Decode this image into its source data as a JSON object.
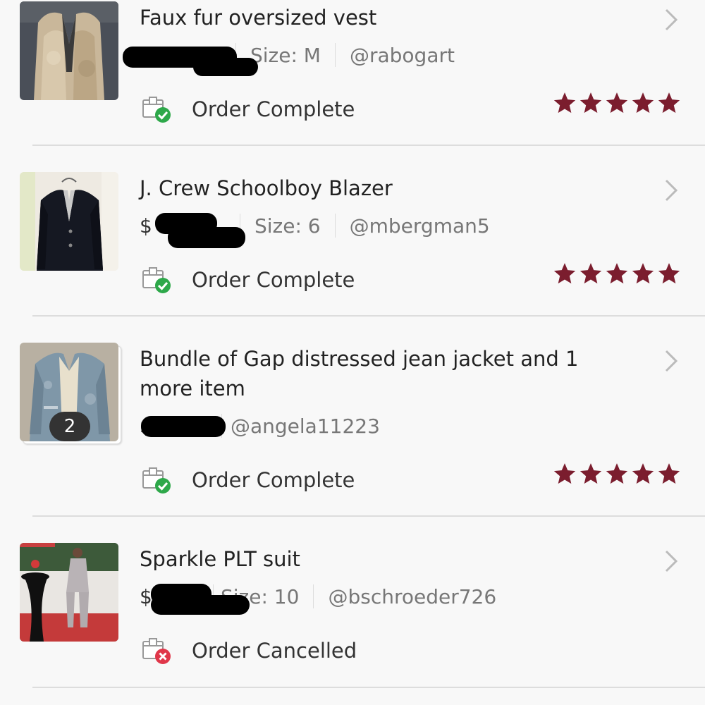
{
  "colors": {
    "star": "#7b1d2e",
    "success": "#2ea84a",
    "danger": "#e0374a",
    "text": "#222222",
    "muted": "#777777"
  },
  "orders": [
    {
      "title": "Faux fur oversized vest",
      "price_prefix": "$",
      "size": "Size: M",
      "seller": "@rabogart",
      "status": "Order Complete",
      "status_icon": "box-check-icon",
      "rating": 5,
      "thumbnail": "faux-fur-vest-photo"
    },
    {
      "title": "J. Crew Schoolboy Blazer",
      "price_prefix": "$",
      "size": "Size: 6",
      "seller": "@mbergman5",
      "status": "Order Complete",
      "status_icon": "box-check-icon",
      "rating": 5,
      "thumbnail": "black-blazer-photo"
    },
    {
      "title": "Bundle of Gap distressed jean jacket and 1 more item",
      "price_prefix": "$",
      "seller": "@angela11223",
      "bundle_count": "2",
      "status": "Order Complete",
      "status_icon": "box-check-icon",
      "rating": 5,
      "thumbnail": "jean-jacket-photo"
    },
    {
      "title": "Sparkle PLT suit",
      "price_prefix": "$",
      "size": "Size: 10",
      "seller": "@bschroeder726",
      "status": "Order Cancelled",
      "status_icon": "box-x-icon",
      "thumbnail": "sparkle-suit-photo"
    }
  ]
}
